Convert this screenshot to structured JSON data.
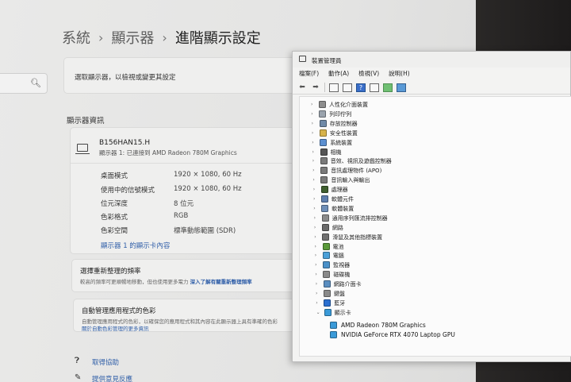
{
  "settings": {
    "breadcrumb": [
      "系統",
      "顯示器",
      "進階顯示設定"
    ],
    "breadcrumb_sep": "›",
    "select_display_label": "選取顯示器，以檢視或變更其設定",
    "display_info_heading": "顯示器資訊",
    "display": {
      "name": "B156HAN15.H",
      "connection": "顯示器 1: 已連接到 AMD Radeon 780M Graphics"
    },
    "info_rows": [
      {
        "label": "桌面模式",
        "value": "1920 × 1080, 60 Hz"
      },
      {
        "label": "使用中的信號模式",
        "value": "1920 × 1080, 60 Hz"
      },
      {
        "label": "位元深度",
        "value": "8 位元"
      },
      {
        "label": "色彩格式",
        "value": "RGB"
      },
      {
        "label": "色彩空間",
        "value": "標準動態範圍 (SDR)"
      }
    ],
    "adapter_link": "顯示器 1 的顯示卡內容",
    "refresh_card": {
      "title": "選擇重新整理的頻率",
      "desc": "較高的頻率可更順暢地移動，但也使用更多電力",
      "link": "深入了解有關重新整理頻率"
    },
    "color_card": {
      "title": "自動管理應用程式的色彩",
      "desc": "自動管理應用程式的色彩，以確保您的應用程式和其內容在此顯示器上具有準確的色彩",
      "link": "關於自動色彩管理的更多資訊"
    },
    "help_link": "取得協助",
    "feedback_link": "提供意見反應"
  },
  "device_manager": {
    "title": "裝置管理員",
    "menus": [
      "檔案(F)",
      "動作(A)",
      "檢視(V)",
      "說明(H)"
    ],
    "categories": [
      {
        "label": "人性化介面裝置",
        "color": "#8d8d8d"
      },
      {
        "label": "列印佇列",
        "color": "#9aa3ad"
      },
      {
        "label": "存放控制器",
        "color": "#6f8aa8"
      },
      {
        "label": "安全性裝置",
        "color": "#d6b24a"
      },
      {
        "label": "系統裝置",
        "color": "#5b8fd0"
      },
      {
        "label": "相機",
        "color": "#555555"
      },
      {
        "label": "音效、視訊及遊戲控制器",
        "color": "#7a7a7a"
      },
      {
        "label": "音訊處理物件 (APO)",
        "color": "#7a7a7a"
      },
      {
        "label": "音訊輸入與輸出",
        "color": "#7a7a7a"
      },
      {
        "label": "處理器",
        "color": "#3f5f2f"
      },
      {
        "label": "軟體元件",
        "color": "#5f7fae"
      },
      {
        "label": "軟體裝置",
        "color": "#6f8fb8"
      },
      {
        "label": "通用序列匯流排控制器",
        "color": "#8a8a8a"
      },
      {
        "label": "網路",
        "color": "#6a6a6a"
      },
      {
        "label": "滑鼠及其他指標裝置",
        "color": "#707070"
      },
      {
        "label": "電池",
        "color": "#5a9a3a"
      },
      {
        "label": "電腦",
        "color": "#4aa0d8"
      },
      {
        "label": "監視器",
        "color": "#4a90c8"
      },
      {
        "label": "磁碟機",
        "color": "#8a8a8a"
      },
      {
        "label": "網路介面卡",
        "color": "#5a8ec0"
      },
      {
        "label": "鍵盤",
        "color": "#8a8a8a"
      },
      {
        "label": "藍牙",
        "color": "#2a6fd0"
      },
      {
        "label": "顯示卡",
        "color": "#3a9ad8"
      }
    ],
    "display_adapters": [
      "AMD Radeon 780M Graphics",
      "NVIDIA GeForce RTX 4070 Laptop GPU"
    ],
    "chevron_collapsed": "›",
    "chevron_expanded": "⌄"
  }
}
